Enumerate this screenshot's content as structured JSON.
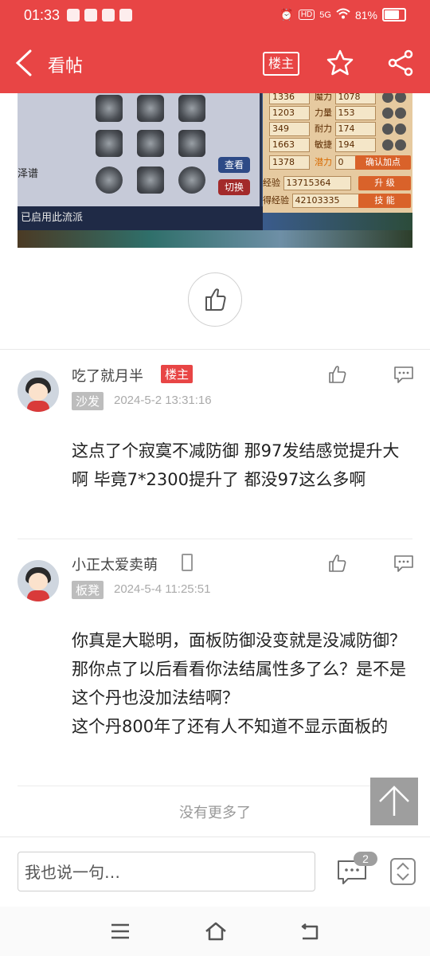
{
  "status_bar": {
    "time": "01:33",
    "network": "5G",
    "hd": "HD",
    "battery": "81%"
  },
  "header": {
    "title": "看帖",
    "op_button": "楼主"
  },
  "post_image": {
    "left_panel_label": "泽谱",
    "enabled_text": "已启用此流派",
    "view_button": "查看",
    "switch_button": "切换",
    "stats": [
      {
        "value": "1336",
        "label": "魔力",
        "value2": "1078"
      },
      {
        "value": "1203",
        "label": "力量",
        "value2": "153"
      },
      {
        "value": "349",
        "label": "耐力",
        "value2": "174"
      },
      {
        "value": "1663",
        "label": "敏捷",
        "value2": "194"
      },
      {
        "value": "1378",
        "label": "潜力",
        "value2": "0"
      }
    ],
    "confirm_button": "确认加点",
    "exp_label_1": "经验",
    "exp_value_1": "13715364",
    "exp_label_2": "得经验",
    "exp_value_2": "42103335",
    "upgrade_button": "升 级",
    "skill_button": "技 能"
  },
  "comments": [
    {
      "user": "吃了就月半",
      "badge": "楼主",
      "floor": "沙发",
      "time": "2024-5-2 13:31:16",
      "content": "这点了个寂寞不减防御 那97发结感觉提升大 啊   毕竟7*2300提升了 都没97这么多啊"
    },
    {
      "user": "小正太爱卖萌",
      "floor": "板凳",
      "time": "2024-5-4 11:25:51",
      "content_lines": [
        "你真是大聪明，面板防御没变就是没减防御？那你点了以后看看你法结属性多了么？是不是这个丹也没加法结啊？",
        "这个丹800年了还有人不知道不显示面板的"
      ]
    }
  ],
  "no_more": "没有更多了",
  "reply": {
    "placeholder": "我也说一句…",
    "comment_count": "2"
  },
  "colors": {
    "brand_red": "#e84545",
    "tag_gray": "#bdbdbd"
  }
}
